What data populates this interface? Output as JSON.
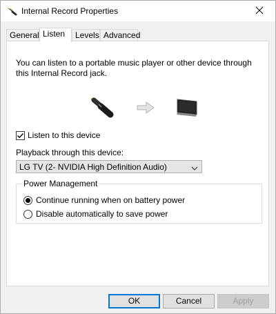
{
  "window": {
    "title": "Internal Record Properties",
    "title_icon": "audio-jack-icon",
    "close_icon": "close-icon"
  },
  "tabs": [
    {
      "label": "General",
      "active": false
    },
    {
      "label": "Listen",
      "active": true
    },
    {
      "label": "Levels",
      "active": false
    },
    {
      "label": "Advanced",
      "active": false
    }
  ],
  "listen": {
    "description": "You can listen to a portable music player or other device through this Internal Record jack.",
    "illustration_icons": [
      "audio-jack-icon",
      "arrow-right-icon",
      "monitor-icon"
    ],
    "listen_checkbox_label": "Listen to this device",
    "listen_checked": true,
    "playback_label": "Playback through this device:",
    "playback_value": "LG TV (2- NVIDIA High Definition Audio)",
    "power_group_label": "Power Management",
    "power_options": [
      {
        "label": "Continue running when on battery power",
        "selected": true
      },
      {
        "label": "Disable automatically to save power",
        "selected": false
      }
    ]
  },
  "buttons": {
    "ok": "OK",
    "cancel": "Cancel",
    "apply": "Apply",
    "apply_enabled": false
  }
}
